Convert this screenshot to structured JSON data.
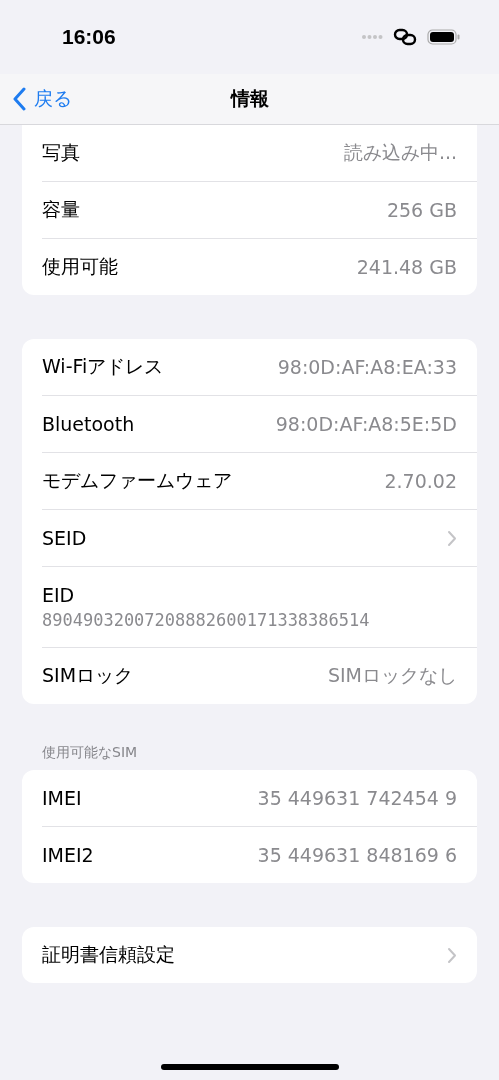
{
  "status_bar": {
    "time": "16:06"
  },
  "nav": {
    "back": "戻る",
    "title": "情報"
  },
  "groups": [
    {
      "rows": [
        {
          "kind": "value",
          "label": "写真",
          "value": "読み込み中..."
        },
        {
          "kind": "value",
          "label": "容量",
          "value": "256 GB"
        },
        {
          "kind": "value",
          "label": "使用可能",
          "value": "241.48 GB"
        }
      ]
    },
    {
      "rows": [
        {
          "kind": "value",
          "label": "Wi-Fiアドレス",
          "value": "98:0D:AF:A8:EA:33"
        },
        {
          "kind": "value",
          "label": "Bluetooth",
          "value": "98:0D:AF:A8:5E:5D"
        },
        {
          "kind": "value",
          "label": "モデムファームウェア",
          "value": "2.70.02"
        },
        {
          "kind": "chevron",
          "label": "SEID"
        },
        {
          "kind": "stacked",
          "label": "EID",
          "value": "89049032007208882600171338386514"
        },
        {
          "kind": "value",
          "label": "SIMロック",
          "value": "SIMロックなし"
        }
      ]
    },
    {
      "header": "使用可能なSIM",
      "rows": [
        {
          "kind": "value",
          "label": "IMEI",
          "value": "35 449631 742454 9"
        },
        {
          "kind": "value",
          "label": "IMEI2",
          "value": "35 449631 848169 6"
        }
      ]
    },
    {
      "rows": [
        {
          "kind": "chevron",
          "label": "証明書信頼設定"
        }
      ]
    }
  ]
}
